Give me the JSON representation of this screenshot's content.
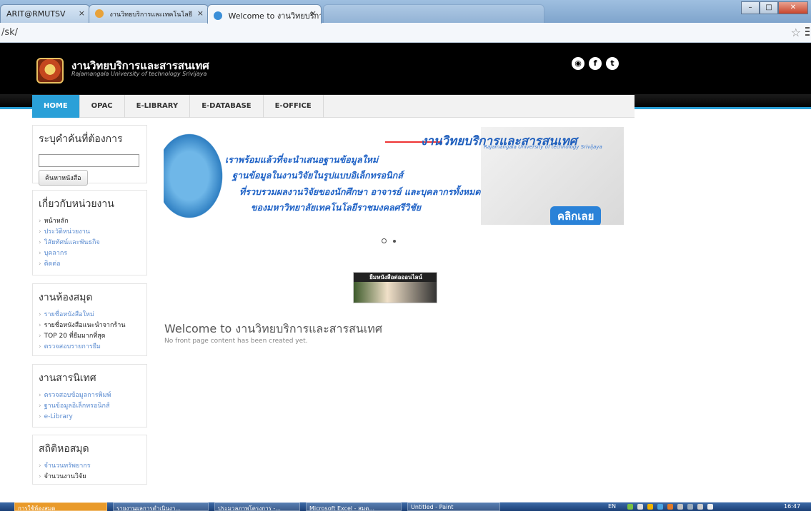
{
  "browser": {
    "tabs": [
      {
        "label": "ARIT@RMUTSV",
        "close": "×"
      },
      {
        "label": "งานวิทยบริการและเทคโนโลยี",
        "close": "×"
      },
      {
        "label": "Welcome to งานวิทยบริการ",
        "close": "×"
      }
    ],
    "address": "/sk/",
    "window_buttons": [
      "–",
      "□",
      "✕"
    ]
  },
  "site": {
    "title": "งานวิทยบริการและสารสนเทศ",
    "subtitle": "Rajamangala University of technology Srivijaya",
    "social_icons": [
      "rss-icon",
      "facebook-icon",
      "twitter-icon"
    ]
  },
  "nav": {
    "items": [
      "HOME",
      "OPAC",
      "E-LIBRARY",
      "E-DATABASE",
      "E-OFFICE"
    ],
    "active": "HOME"
  },
  "sidebar": {
    "search": {
      "title": "ระบุคำค้นที่ต้องการ",
      "value": "",
      "button": "ค้นหาหนังสือ"
    },
    "about": {
      "title": "เกี่ยวกับหน่วยงาน",
      "items": [
        "หน้าหลัก",
        "ประวัติหน่วยงาน",
        "วิสัยทัศน์และพันธกิจ",
        "บุคลากร",
        "ติดต่อ"
      ]
    },
    "library": {
      "title": "งานห้องสมุด",
      "items": [
        "รายชื่อหนังสือใหม่",
        "รายชื่อหนังสือแนะนำจากร้าน",
        "TOP 20 ที่ยืมมากที่สุด",
        "ตรวจสอบรายการยืม"
      ]
    },
    "info": {
      "title": "งานสารนิเทศ",
      "items": [
        "ตรวจสอบข้อมูลการพิมพ์",
        "ฐานข้อมูลอิเล็กทรอนิกส์",
        "e-Library"
      ]
    },
    "stats": {
      "title": "สถิติหอสมุด",
      "items": [
        "จำนวนทรัพยากร",
        "จำนวนงานวิจัย"
      ]
    }
  },
  "banner": {
    "title": "งานวิทยบริการและสารสนเทศ",
    "subtitle": "Rajamangala University of technology Srivijaya",
    "lines": [
      "เราพร้อมแล้วที่จะนำเสนอฐานข้อมูลใหม่",
      "ฐานข้อมูลในงานวิจัยในรูปแบบอิเล็กทรอนิกส์",
      "ที่รวบรวมผลงานวิจัยของนักศึกษา อาจารย์ และบุคลากรทั้งหมด",
      "ของมหาวิทยาลัยเทคโนโลยีราชมงคลศรีวิชัย"
    ],
    "cta": "คลิกเลย"
  },
  "promo": {
    "label": "ยืมหนังสือต่อออนไลน์"
  },
  "content": {
    "welcome": "Welcome to งานวิทยบริการและสารสนเทศ",
    "empty": "No front page content has been created yet."
  },
  "taskbar": {
    "items": [
      "การใช้ห้องสมุด",
      "รายงานผลการดำเนินงา...",
      "ประมวลภาพโครงการ -...",
      "Microsoft Excel - สมุด...",
      "Untitled - Paint"
    ],
    "lang": "EN",
    "clock": "16:47"
  }
}
